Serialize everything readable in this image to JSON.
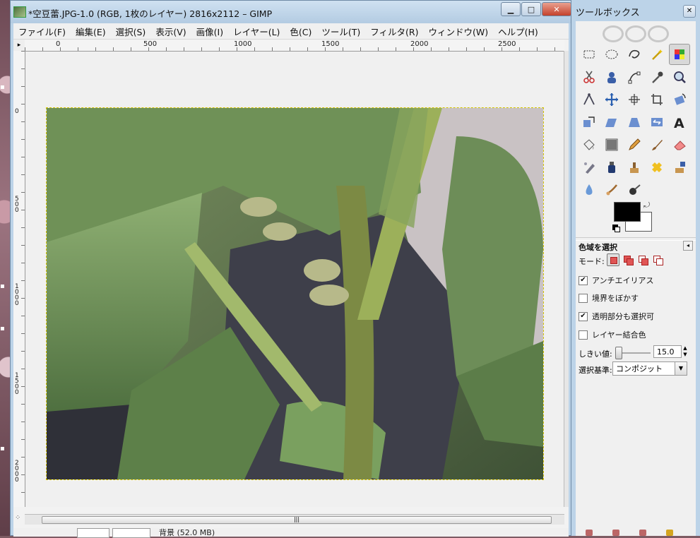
{
  "image_window": {
    "title": "*空豆蕾.JPG-1.0 (RGB, 1枚のレイヤー) 2816x2112 – GIMP",
    "minimize": "▁",
    "maximize": "□",
    "close": "✕"
  },
  "menu": [
    "ファイル(F)",
    "編集(E)",
    "選択(S)",
    "表示(V)",
    "画像(I)",
    "レイヤー(L)",
    "色(C)",
    "ツール(T)",
    "フィルタ(R)",
    "ウィンドウ(W)",
    "ヘルプ(H)"
  ],
  "rulers": {
    "h_labels": [
      "0",
      "500",
      "1000",
      "1500",
      "2000",
      "2500"
    ],
    "v_labels": [
      "0",
      "500",
      "1000",
      "1500",
      "2000"
    ]
  },
  "statusbar": {
    "text": "背景 (52.0 MB)"
  },
  "toolbox": {
    "title": "ツールボックス",
    "close": "✕",
    "tools": [
      "rect-select-icon",
      "ellipse-select-icon",
      "free-select-icon",
      "fuzzy-select-icon",
      "color-select-icon",
      "scissors-icon",
      "foreground-select-icon",
      "paths-icon",
      "color-picker-icon",
      "zoom-icon",
      "measure-icon",
      "move-icon",
      "align-icon",
      "crop-icon",
      "rotate-icon",
      "scale-icon",
      "shear-icon",
      "perspective-icon",
      "flip-icon",
      "text-icon",
      "bucket-fill-icon",
      "blend-icon",
      "pencil-icon",
      "paintbrush-icon",
      "eraser-icon",
      "airbrush-icon",
      "ink-icon",
      "clone-icon",
      "heal-icon",
      "perspective-clone-icon",
      "blur-icon",
      "smudge-icon",
      "dodge-burn-icon"
    ],
    "active_tool_index": 4,
    "fg_color": "#000000",
    "bg_color": "#ffffff"
  },
  "tool_options": {
    "title": "色域を選択",
    "mode_label": "モード:",
    "antialias": {
      "label": "アンチエイリアス",
      "checked": true
    },
    "feather": {
      "label": "境界をぼかす",
      "checked": false
    },
    "transparent": {
      "label": "透明部分も選択可",
      "checked": true
    },
    "sample_merged": {
      "label": "レイヤー結合色",
      "checked": false
    },
    "threshold_label": "しきい値:",
    "threshold_value": "15.0",
    "criterion_label": "選択基準:",
    "criterion_value": "コンポジット"
  }
}
